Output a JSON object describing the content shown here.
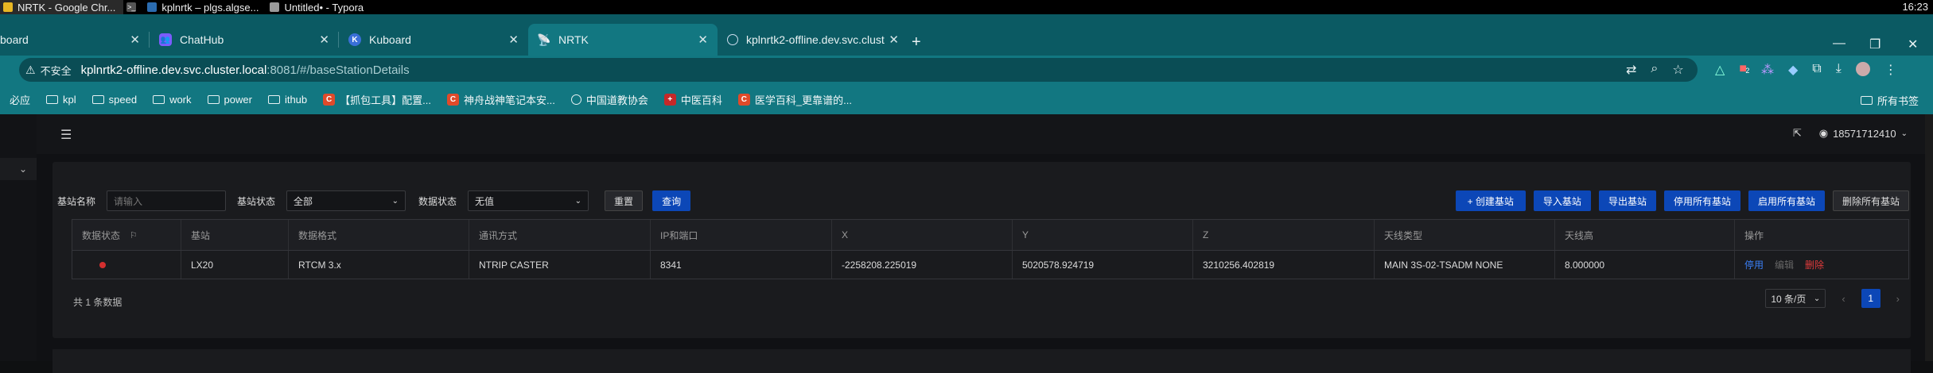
{
  "os": {
    "tasks": [
      {
        "label": "NRTK - Google Chr...",
        "color": "#e8b623"
      },
      {
        "label": "kplnrtk – plgs.algse...",
        "color": "#2b6cb0"
      },
      {
        "label": "Untitled• - Typora",
        "color": "#999999"
      }
    ],
    "clock": "16:23"
  },
  "browser": {
    "tabs": [
      {
        "label": "board",
        "favicon": "none"
      },
      {
        "label": "ChatHub",
        "favicon": "chathub-icon"
      },
      {
        "label": "Kuboard",
        "favicon": "kuboard-icon"
      },
      {
        "label": "NRTK",
        "favicon": "nrtk-icon"
      },
      {
        "label": "kplnrtk2-offline.dev.svc.clust",
        "favicon": "globe-icon"
      }
    ],
    "new_tab": "+",
    "security_label": "不安全",
    "url_host": "kplnrtk2-offline.dev.svc.cluster.local",
    "url_rest": ":8081/#/baseStationDetails",
    "bookmarks": [
      {
        "label": "必应",
        "type": "plain"
      },
      {
        "label": "kpl",
        "type": "folder"
      },
      {
        "label": "speed",
        "type": "folder"
      },
      {
        "label": "work",
        "type": "folder"
      },
      {
        "label": "power",
        "type": "folder"
      },
      {
        "label": "ithub",
        "type": "folder"
      },
      {
        "label": "【抓包工具】配置...",
        "type": "c-icon"
      },
      {
        "label": "神舟战神笔记本安...",
        "type": "c-icon"
      },
      {
        "label": "中国道教协会",
        "type": "globe"
      },
      {
        "label": "中医百科",
        "type": "med"
      },
      {
        "label": "医学百科_更靠谱的...",
        "type": "c-icon"
      }
    ],
    "all_bookmarks": "所有书签",
    "badge_count": "2"
  },
  "app": {
    "user": "18571712410",
    "filters": {
      "name_label": "基站名称",
      "name_placeholder": "请输入",
      "status_label": "基站状态",
      "status_value": "全部",
      "data_status_label": "数据状态",
      "data_status_value": "无值",
      "reset": "重置",
      "query": "查询"
    },
    "actions": {
      "create": "+ 创建基站",
      "import": "导入基站",
      "export": "导出基站",
      "disable_all": "停用所有基站",
      "enable_all": "启用所有基站",
      "delete_all": "删除所有基站"
    },
    "table": {
      "headers": [
        "数据状态",
        "基站",
        "数据格式",
        "通讯方式",
        "IP和端口",
        "X",
        "Y",
        "Z",
        "天线类型",
        "天线高",
        "操作"
      ],
      "rows": [
        {
          "status_color": "#d32f2f",
          "station": "LX20",
          "format": "RTCM 3.x",
          "comm": "NTRIP CASTER",
          "ip_port": "8341",
          "x": "-2258208.225019",
          "y": "5020578.924719",
          "z": "3210256.402819",
          "antenna": "MAIN 3S-02-TSADM NONE",
          "antenna_height": "8.000000",
          "op_enable": "停用",
          "op_edit": "编辑",
          "op_delete": "删除"
        }
      ]
    },
    "total": "共 1 条数据",
    "page_size": "10 条/页",
    "current_page": "1"
  }
}
